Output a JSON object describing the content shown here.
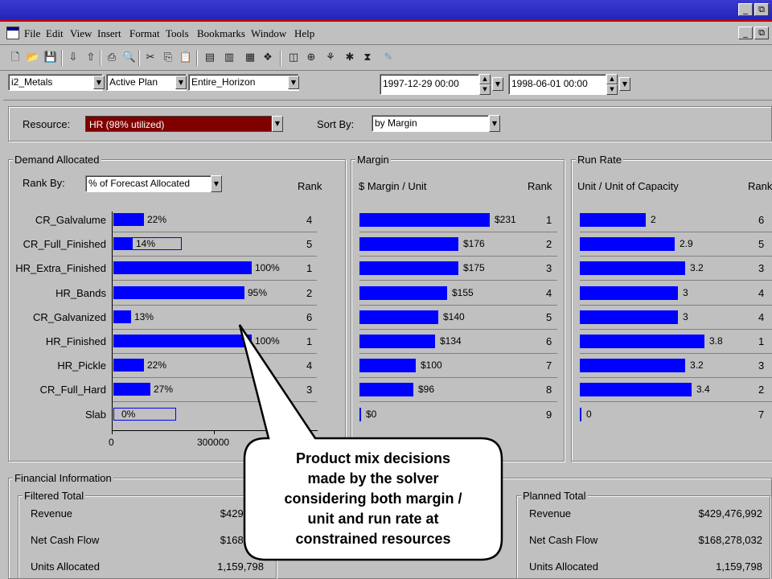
{
  "menu": [
    "File",
    "Edit",
    "View",
    "Insert",
    "Format",
    "Tools",
    "Bookmarks",
    "Window",
    "Help"
  ],
  "window_buttons": {
    "minimize": "_",
    "restore": "⧉"
  },
  "selectors": {
    "model": "i2_Metals",
    "plan": "Active Plan",
    "horizon": "Entire_Horizon",
    "start_time": "1997-12-29 00:00",
    "end_time": "1998-06-01 00:00"
  },
  "resource": {
    "label": "Resource:",
    "value": "HR (98% utilized)",
    "value_color": "#800000"
  },
  "sort": {
    "label": "Sort By:",
    "value": "by Margin"
  },
  "demand": {
    "title": "Demand Allocated",
    "rank_by_label": "Rank By:",
    "rank_by_value": "% of Forecast Allocated",
    "rank_header": "Rank",
    "axis_ticks": [
      "0",
      "300000"
    ],
    "rows": [
      {
        "name": "CR_Galvalume",
        "pct": "22%",
        "rank": "4",
        "filled": 0.22
      },
      {
        "name": "CR_Full_Finished",
        "pct": "14%",
        "rank": "5",
        "filled": 0.14
      },
      {
        "name": "HR_Extra_Finished",
        "pct": "100%",
        "rank": "1",
        "filled": 1.0
      },
      {
        "name": "HR_Bands",
        "pct": "95%",
        "rank": "2",
        "filled": 0.95
      },
      {
        "name": "CR_Galvanized",
        "pct": "13%",
        "rank": "6",
        "filled": 0.13
      },
      {
        "name": "HR_Finished",
        "pct": "100%",
        "rank": "1",
        "filled": 1.0
      },
      {
        "name": "HR_Pickle",
        "pct": "22%",
        "rank": "4",
        "filled": 0.22
      },
      {
        "name": "CR_Full_Hard",
        "pct": "27%",
        "rank": "3",
        "filled": 0.27
      },
      {
        "name": "Slab",
        "pct": "0%",
        "rank": "",
        "filled": 0.0
      }
    ]
  },
  "margin": {
    "title": "Margin",
    "header": "$ Margin / Unit",
    "rank_header": "Rank",
    "rows": [
      {
        "label": "$231",
        "value": 231,
        "rank": "1"
      },
      {
        "label": "$176",
        "value": 176,
        "rank": "2"
      },
      {
        "label": "$175",
        "value": 175,
        "rank": "3"
      },
      {
        "label": "$155",
        "value": 155,
        "rank": "4"
      },
      {
        "label": "$140",
        "value": 140,
        "rank": "5"
      },
      {
        "label": "$134",
        "value": 134,
        "rank": "6"
      },
      {
        "label": "$100",
        "value": 100,
        "rank": "7"
      },
      {
        "label": "$96",
        "value": 96,
        "rank": "8"
      },
      {
        "label": "$0",
        "value": 0,
        "rank": "9"
      }
    ]
  },
  "runrate": {
    "title": "Run Rate",
    "header": "Unit / Unit of Capacity",
    "rank_header": "Rank",
    "rows": [
      {
        "label": "2",
        "value": 2,
        "rank": "6"
      },
      {
        "label": "2.9",
        "value": 2.9,
        "rank": "5"
      },
      {
        "label": "3.2",
        "value": 3.2,
        "rank": "3"
      },
      {
        "label": "3",
        "value": 3,
        "rank": "4"
      },
      {
        "label": "3",
        "value": 3,
        "rank": "4"
      },
      {
        "label": "3.8",
        "value": 3.8,
        "rank": "1"
      },
      {
        "label": "3.2",
        "value": 3.2,
        "rank": "3"
      },
      {
        "label": "3.4",
        "value": 3.4,
        "rank": "2"
      },
      {
        "label": "0",
        "value": 0,
        "rank": "7"
      }
    ]
  },
  "financial": {
    "title": "Financial Information",
    "filtered": {
      "title": "Filtered Total",
      "rows": [
        {
          "label": "Revenue",
          "value": "$429,476"
        },
        {
          "label": "Net Cash Flow",
          "value": "$168,278"
        },
        {
          "label": "Units Allocated",
          "value": "1,159,798"
        }
      ]
    },
    "planned": {
      "title": "Planned Total",
      "rows": [
        {
          "label": "Revenue",
          "value": "$429,476,992"
        },
        {
          "label": "Net Cash Flow",
          "value": "$168,278,032"
        },
        {
          "label": "Units Allocated",
          "value": "1,159,798"
        }
      ]
    }
  },
  "callout": {
    "lines": [
      "Product mix decisions",
      "made by the solver",
      "considering both margin /",
      "unit and run rate at",
      "constrained resources"
    ]
  },
  "colors": {
    "bar": "#0000ff",
    "titlebar": "#2323b8",
    "accent_red": "#c00000"
  }
}
